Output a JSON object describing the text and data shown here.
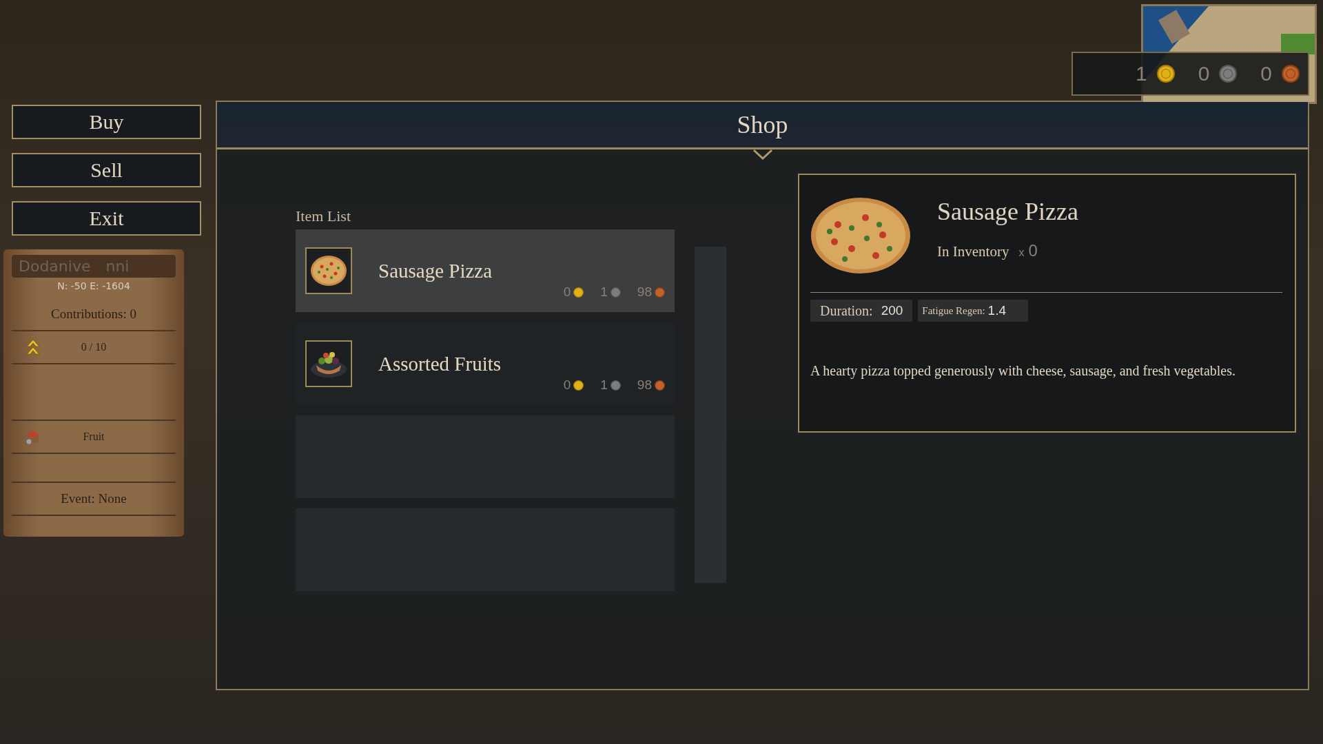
{
  "hud": {
    "currency": [
      {
        "kind": "gold",
        "amount": "1"
      },
      {
        "kind": "silver",
        "amount": "0"
      },
      {
        "kind": "copper",
        "amount": "0"
      }
    ]
  },
  "menu": [
    {
      "label": "Buy"
    },
    {
      "label": "Sell"
    },
    {
      "label": "Exit"
    }
  ],
  "scroll": {
    "name_parts": [
      "Dodanive",
      "nni"
    ],
    "coords": "N: -50  E: -1604",
    "contributions": "Contributions: 0",
    "rank": "0 / 10",
    "specialty": "Fruit",
    "event": "Event: None"
  },
  "shop": {
    "title": "Shop",
    "list_title": "Item List",
    "items": [
      {
        "kind": "pizza",
        "name": "Sausage Pizza",
        "selected": true,
        "prices": [
          {
            "kind": "gold",
            "amount": "0"
          },
          {
            "kind": "silver",
            "amount": "1"
          },
          {
            "kind": "copper",
            "amount": "98"
          }
        ]
      },
      {
        "kind": "fruit",
        "name": "Assorted Fruits",
        "selected": false,
        "prices": [
          {
            "kind": "gold",
            "amount": "0"
          },
          {
            "kind": "silver",
            "amount": "1"
          },
          {
            "kind": "copper",
            "amount": "98"
          }
        ]
      },
      {
        "kind": "empty"
      },
      {
        "kind": "empty"
      }
    ],
    "detail": {
      "kind": "pizza",
      "name": "Sausage Pizza",
      "inventory_label": "In Inventory",
      "count_prefix": "x",
      "count": "0",
      "stats": [
        {
          "kind": "large",
          "label": "Duration:",
          "value": "200"
        },
        {
          "kind": "small",
          "label": "Fatigue Regen:",
          "value": "1.4"
        }
      ],
      "description": "A hearty pizza topped generously with cheese, sausage, and fresh vegetables."
    }
  }
}
